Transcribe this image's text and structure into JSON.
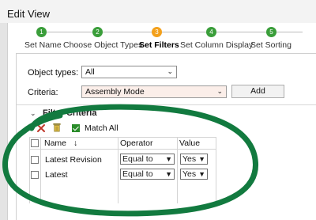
{
  "window": {
    "title": "Edit View"
  },
  "wizard": {
    "steps": [
      {
        "number": "1",
        "label": "Set Name",
        "active": false
      },
      {
        "number": "2",
        "label": "Choose Object Types",
        "active": false
      },
      {
        "number": "3",
        "label": "Set Filters",
        "active": true
      },
      {
        "number": "4",
        "label": "Set Column Display",
        "active": false
      },
      {
        "number": "5",
        "label": "Set Sorting",
        "active": false
      }
    ]
  },
  "form": {
    "object_types_label": "Object types:",
    "object_types_value": "All",
    "criteria_label": "Criteria:",
    "criteria_value": "Assembly Mode",
    "add_label": "Add"
  },
  "filter_criteria": {
    "title": "Filter Criteria",
    "match_all_label": "Match All",
    "match_all_checked": true,
    "columns": [
      "Name",
      "Operator",
      "Value"
    ],
    "sort_indicator": "↓",
    "rows": [
      {
        "name": "Latest Revision",
        "operator": "Equal to",
        "value": "Yes"
      },
      {
        "name": "Latest",
        "operator": "Equal to",
        "value": "Yes"
      }
    ]
  },
  "colors": {
    "step_complete": "#3a9e3a",
    "step_active": "#f3a01b",
    "annotation": "#127a3f"
  },
  "icons": {
    "delete": "close-icon",
    "clear": "trash-icon",
    "dropdown": "chevron-down-icon",
    "collapse": "chevron-down-icon"
  }
}
